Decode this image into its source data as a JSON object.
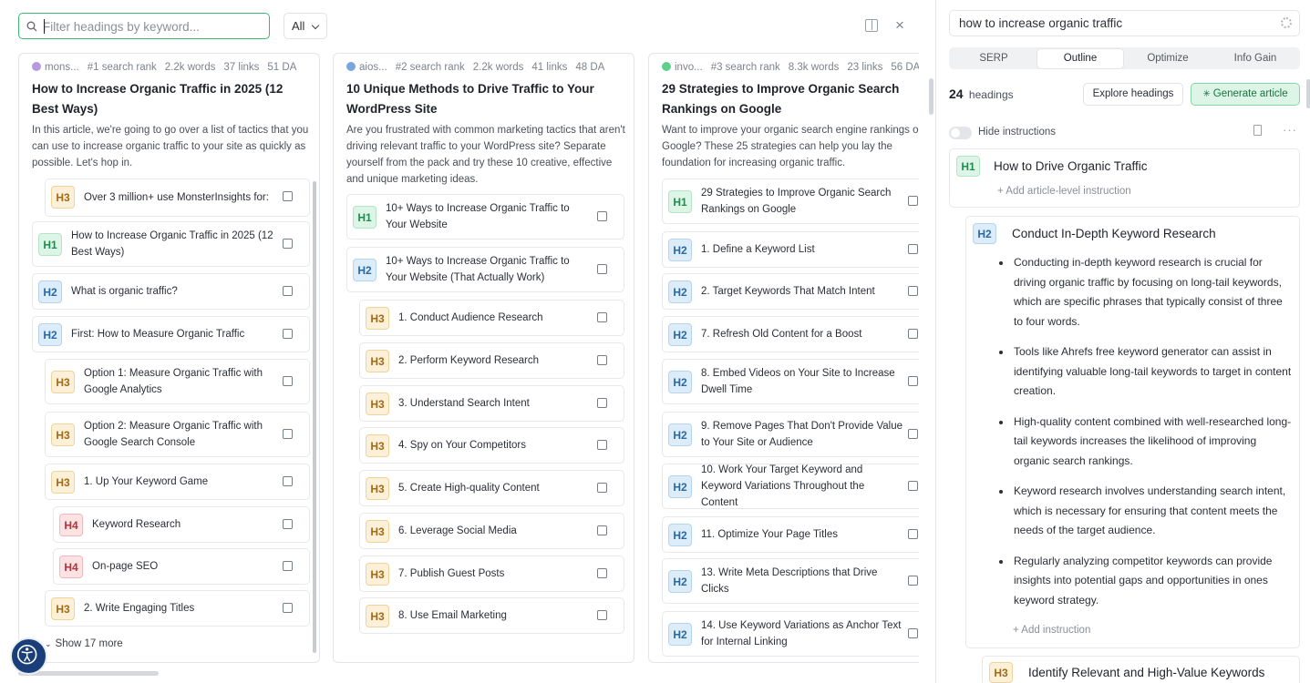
{
  "toolbar": {
    "search_placeholder": "Filter headings by keyword...",
    "filter_value": "All"
  },
  "cards": [
    {
      "source": "mons...",
      "rank": "#1 search rank",
      "words": "2.2k words",
      "links": "37 links",
      "da": "51 DA",
      "favicon_color": "#b49be0",
      "title": "How to Increase Organic Traffic in 2025 (12 Best Ways)",
      "description": "In this article, we're going to go over a list of tactics that you can use to increase organic traffic to your site as quickly as possible. Let's hop in.",
      "headings": [
        {
          "level": "H3",
          "text": "Over 3 million+ use MonsterInsights for:"
        },
        {
          "level": "H1",
          "text": "How to Increase Organic Traffic in 2025 (12 Best Ways)"
        },
        {
          "level": "H2",
          "text": "What is organic traffic?"
        },
        {
          "level": "H2",
          "text": "First: How to Measure Organic Traffic"
        },
        {
          "level": "H3",
          "text": "Option 1: Measure Organic Traffic with Google Analytics"
        },
        {
          "level": "H3",
          "text": "Option 2: Measure Organic Traffic with Google Search Console"
        },
        {
          "level": "H3",
          "text": "1. Up Your Keyword Game"
        },
        {
          "level": "H4",
          "text": "Keyword Research"
        },
        {
          "level": "H4",
          "text": "On-page SEO"
        },
        {
          "level": "H3",
          "text": "2. Write Engaging Titles"
        }
      ],
      "show_more": "Show 17 more"
    },
    {
      "source": "aios...",
      "rank": "#2 search rank",
      "words": "2.2k words",
      "links": "41 links",
      "da": "48 DA",
      "favicon_color": "#7aa6e0",
      "title": "10 Unique Methods to Drive Traffic to Your WordPress Site",
      "description": "Are you frustrated with common marketing tactics that aren't driving relevant traffic to your WordPress site? Separate yourself from the pack and try these 10 creative, effective and unique marketing ideas.",
      "headings": [
        {
          "level": "H1",
          "text": "10+ Ways to Increase Organic Traffic to Your Website"
        },
        {
          "level": "H2",
          "text": "10+ Ways to Increase Organic Traffic to Your Website (That Actually Work)"
        },
        {
          "level": "H3",
          "text": "1. Conduct Audience Research"
        },
        {
          "level": "H3",
          "text": "2. Perform Keyword Research"
        },
        {
          "level": "H3",
          "text": "3. Understand Search Intent"
        },
        {
          "level": "H3",
          "text": "4. Spy on Your Competitors"
        },
        {
          "level": "H3",
          "text": "5. Create High-quality Content"
        },
        {
          "level": "H3",
          "text": "6. Leverage Social Media"
        },
        {
          "level": "H3",
          "text": "7. Publish Guest Posts"
        },
        {
          "level": "H3",
          "text": "8. Use Email Marketing"
        }
      ]
    },
    {
      "source": "invo...",
      "rank": "#3 search rank",
      "words": "8.3k words",
      "links": "23 links",
      "da": "56 DA",
      "favicon_color": "#5fcf8e",
      "title": "29 Strategies to Improve Organic Search Rankings on Google",
      "description": "Want to improve your organic search engine rankings on Google? These 25 strategies can help you lay the foundation for increasing organic traffic.",
      "headings": [
        {
          "level": "H1",
          "text": "29 Strategies to Improve Organic Search Rankings on Google"
        },
        {
          "level": "H2",
          "text": "1. Define a Keyword List"
        },
        {
          "level": "H2",
          "text": "2. Target Keywords That Match Intent"
        },
        {
          "level": "H2",
          "text": "7. Refresh Old Content for a Boost"
        },
        {
          "level": "H2",
          "text": "8. Embed Videos on Your Site to Increase Dwell Time"
        },
        {
          "level": "H2",
          "text": "9. Remove Pages That Don't Provide Value to Your Site or Audience"
        },
        {
          "level": "H2",
          "text": "10. Work Your Target Keyword and Keyword Variations Throughout the Content"
        },
        {
          "level": "H2",
          "text": "11. Optimize Your Page Titles"
        },
        {
          "level": "H2",
          "text": "13. Write Meta Descriptions that Drive Clicks"
        },
        {
          "level": "H2",
          "text": "14. Use Keyword Variations as Anchor Text for Internal Linking"
        }
      ]
    }
  ],
  "panel": {
    "keyword": "how to increase organic traffic",
    "tabs": [
      "SERP",
      "Outline",
      "Optimize",
      "Info Gain"
    ],
    "active_tab": "Outline",
    "heading_count": "24",
    "heading_count_label": "headings",
    "explore_label": "Explore headings",
    "generate_label": "Generate article",
    "hide_instructions_label": "Hide instructions",
    "outline": {
      "h1": {
        "level": "H1",
        "title": "How to Drive Organic Traffic",
        "add_label": "+ Add article-level instruction"
      },
      "h2": {
        "level": "H2",
        "title": "Conduct In-Depth Keyword Research",
        "bullets": [
          "Conducting in-depth keyword research is crucial for driving organic traffic by focusing on long-tail keywords, which are specific phrases that typically consist of three to four words.",
          "Tools like Ahrefs free keyword generator can assist in identifying valuable long-tail keywords to target in content creation.",
          "High-quality content combined with well-researched long-tail keywords increases the likelihood of improving organic search rankings.",
          "Keyword research involves understanding search intent, which is necessary for ensuring that content meets the needs of the target audience.",
          "Regularly analyzing competitor keywords can provide insights into potential gaps and opportunities in ones keyword strategy."
        ],
        "add_label": "+ Add instruction"
      },
      "h3": {
        "level": "H3",
        "title": "Identify Relevant and High-Value Keywords"
      }
    }
  }
}
